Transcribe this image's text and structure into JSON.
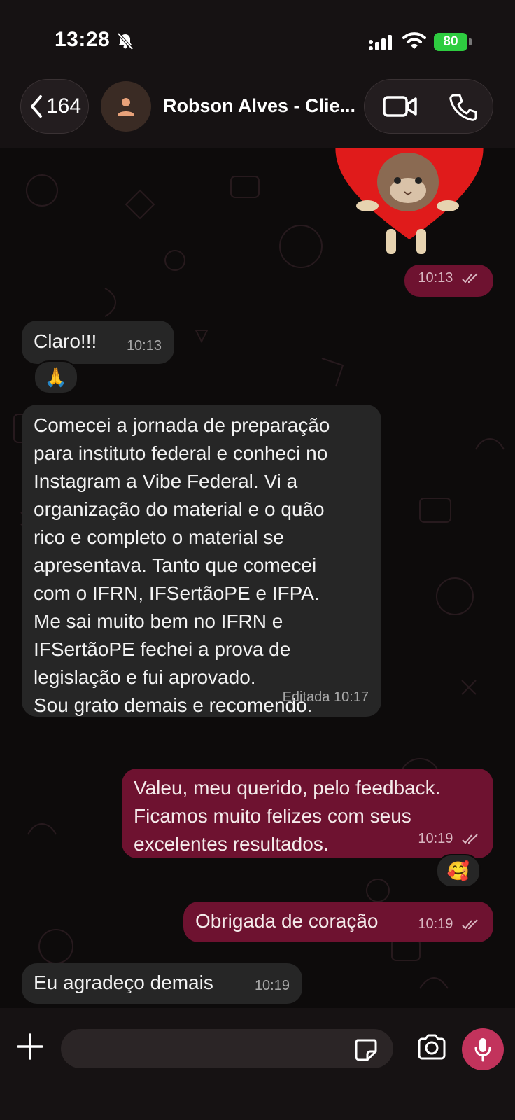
{
  "status_bar": {
    "time": "13:28",
    "battery": "80"
  },
  "header": {
    "back_count": "164",
    "contact_name": "Robson Alves - Clie..."
  },
  "messages": [
    {
      "time": "10:13"
    },
    {
      "text": "Claro!!!",
      "time": "10:13",
      "reaction": "🙏"
    },
    {
      "lines": [
        "Comecei a jornada de preparação",
        "para instituto federal e conheci no",
        "Instagram a Vibe Federal. Vi a",
        "organização do material e o quão",
        "rico e completo o material se",
        "apresentava. Tanto que comecei",
        "com o IFRN, IFSertãoPE e IFPA.",
        "Me sai muito bem no IFRN e",
        "IFSertãoPE fechei a prova de",
        "legislação e fui aprovado.",
        "Sou grato demais e recomendo."
      ],
      "meta": "Editada 10:17"
    },
    {
      "lines": [
        "Valeu, meu querido, pelo feedback.",
        "Ficamos muito felizes com seus",
        "excelentes resultados."
      ],
      "time": "10:19",
      "reaction": "🥰"
    },
    {
      "text": "Obrigada de coração",
      "time": "10:19"
    },
    {
      "text": "Eu agradeço demais",
      "time": "10:19"
    }
  ],
  "colors": {
    "outgoing": "#6e1230",
    "incoming": "#262626",
    "mic": "#c2335c",
    "battery": "#2ecc40"
  }
}
